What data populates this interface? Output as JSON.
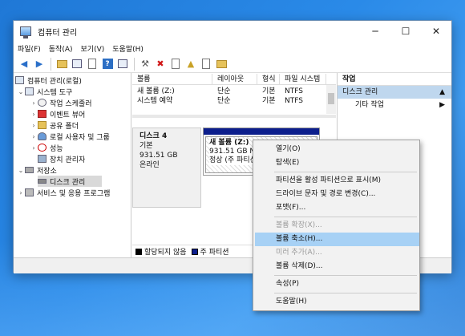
{
  "window": {
    "title": "컴퓨터 관리",
    "min": "─",
    "max": "☐",
    "close": "✕"
  },
  "menu": [
    "파일(F)",
    "동작(A)",
    "보기(V)",
    "도움말(H)"
  ],
  "tree": {
    "root": "컴퓨터 관리(로컬)",
    "system_tools": "시스템 도구",
    "task_scheduler": "작업 스케줄러",
    "event_viewer": "이벤트 뷰어",
    "shared_folders": "공유 폴더",
    "local_users": "로컬 사용자 및 그룹",
    "performance": "성능",
    "device_manager": "장치 관리자",
    "storage": "저장소",
    "disk_management": "디스크 관리",
    "services": "서비스 및 응용 프로그램"
  },
  "list": {
    "headers": [
      "볼륨",
      "레이아웃",
      "형식",
      "파일 시스템"
    ],
    "rows": [
      [
        "새 볼륨 (Z:)",
        "단순",
        "기본",
        "NTFS"
      ],
      [
        "시스템 예약",
        "단순",
        "기본",
        "NTFS"
      ]
    ]
  },
  "disk": {
    "name": "디스크 4",
    "type": "기본",
    "size": "931.51 GB",
    "status": "온라인",
    "volume_name": "새 볼륨  (Z:)",
    "volume_size": "931.51 GB NTFS",
    "volume_status": "정상 (주 파티션)"
  },
  "legend": [
    {
      "label": "할당되지 않음",
      "color": "#000000"
    },
    {
      "label": "주 파티션",
      "color": "#0c1e8c"
    }
  ],
  "actions": {
    "header": "작업",
    "section": "디스크 관리",
    "more": "기타 작업"
  },
  "context_menu": [
    {
      "label": "열기(O)",
      "disabled": false
    },
    {
      "label": "탐색(E)",
      "disabled": false
    },
    {
      "label": "파티션을 활성 파티션으로 표시(M)",
      "disabled": false
    },
    {
      "label": "드라이브 문자 및 경로 변경(C)...",
      "disabled": false
    },
    {
      "label": "포맷(F)...",
      "disabled": false
    },
    {
      "label": "볼륨 확장(X)...",
      "disabled": true
    },
    {
      "label": "볼륨 축소(H)...",
      "disabled": false,
      "highlighted": true
    },
    {
      "label": "미러 추가(A)...",
      "disabled": true
    },
    {
      "label": "볼륨 삭제(D)...",
      "disabled": false
    },
    {
      "label": "속성(P)",
      "disabled": false
    },
    {
      "label": "도움말(H)",
      "disabled": false
    }
  ],
  "colors": {
    "accent": "#0c1e8c",
    "highlight": "#a7d1f5",
    "section": "#bfd7ee"
  }
}
